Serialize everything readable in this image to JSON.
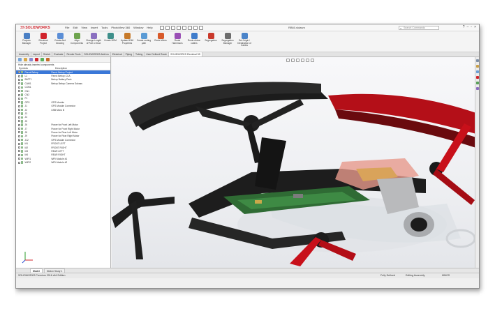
{
  "app": {
    "logo_prefix": "3S",
    "logo_text": "SOLIDWORKS",
    "document_title": "RB60.sldasm",
    "search_placeholder": "Search Commands"
  },
  "menu": [
    "File",
    "Edit",
    "View",
    "Insert",
    "Tools",
    "PhotoView 360",
    "Window",
    "Help"
  ],
  "ribbon": [
    {
      "label": "Projects Manager",
      "color": "#4a7fc4"
    },
    {
      "label": "Electrical Project",
      "color": "#d0232b"
    },
    {
      "label": "Create Add Drawing",
      "color": "#5b8ed6"
    },
    {
      "label": "Align Components",
      "color": "#6da34d"
    },
    {
      "label": "Change Length of Part or Duct",
      "color": "#8a6fc0"
    },
    {
      "label": "Create BOM",
      "color": "#3e8f8a"
    },
    {
      "label": "Update BOM Properties",
      "color": "#c77a2a"
    },
    {
      "label": "Create routing path",
      "color": "#5a9bd5"
    },
    {
      "label": "Route Wires",
      "color": "#d85a2a"
    },
    {
      "label": "Route Harnesses",
      "color": "#9a4fb5"
    },
    {
      "label": "Route ribbon cables",
      "color": "#3f7ccb"
    },
    {
      "label": "Segregation",
      "color": "#c9392b"
    },
    {
      "label": "Segregation Manager",
      "color": "#6c6c6c"
    },
    {
      "label": "Set Origin / Destination of Cables",
      "color": "#4b84c9"
    }
  ],
  "tabs": [
    "Assembly",
    "Layout",
    "Sketch",
    "Evaluate",
    "Render Tools",
    "SOLIDWORKS Add-Ins",
    "Electrical",
    "Piping",
    "Tubing",
    "User Defined Route",
    "SOLIDWORKS Electrical 3D"
  ],
  "active_tab": "SOLIDWORKS Electrical 3D",
  "panel": {
    "hide_label": "Hide already inserted components",
    "col_symbols": "Symbols",
    "col_description": "Description",
    "rows": [
      {
        "symbol": "Parrot Bebop",
        "description": "Parrot Bebop Project",
        "selected": true
      },
      {
        "symbol": "L1",
        "description": "Parrot Bebop CCA"
      },
      {
        "symbol": "BATT1",
        "description": "Bebop Battery Pack"
      },
      {
        "symbol": "CAM1",
        "description": "Bebop Bebop Camera Subass"
      },
      {
        "symbol": "CON1",
        "description": ""
      },
      {
        "symbol": "CN1",
        "description": ""
      },
      {
        "symbol": "CN2",
        "description": ""
      },
      {
        "symbol": "F1",
        "description": ""
      },
      {
        "symbol": "GPS",
        "description": "GPS Module"
      },
      {
        "symbol": "J1",
        "description": "GPS Module Connector"
      },
      {
        "symbol": "J2",
        "description": "USB Micro B"
      },
      {
        "symbol": "J3",
        "description": ""
      },
      {
        "symbol": "J4",
        "description": ""
      },
      {
        "symbol": "J5",
        "description": ""
      },
      {
        "symbol": "J6",
        "description": "Power for Front Left Motor"
      },
      {
        "symbol": "J7",
        "description": "Power for Front Right Motor"
      },
      {
        "symbol": "J8",
        "description": "Power for Rear Left Motor"
      },
      {
        "symbol": "J9",
        "description": "Power for Rear Right Motor"
      },
      {
        "symbol": "J12",
        "description": "GPS Module Connector"
      },
      {
        "symbol": "M1",
        "description": "FRONT LEFT"
      },
      {
        "symbol": "M2",
        "description": "FRONT RIGHT"
      },
      {
        "symbol": "M3",
        "description": "REAR LEFT"
      },
      {
        "symbol": "M4",
        "description": "REAR RIGHT"
      },
      {
        "symbol": "WIFI1",
        "description": "WiFi Module #1"
      },
      {
        "symbol": "WIFI2",
        "description": "WiFi Module #2"
      }
    ]
  },
  "bottom_tabs": [
    "Model",
    "Motion Study 1"
  ],
  "status": {
    "edition": "SOLIDWORKS Premium 2016 x64 Edition",
    "defined": "Fully Defined",
    "editing": "Editing Assembly",
    "units": "MMGS"
  },
  "colors": {
    "brand_red": "#d0232b",
    "selection_blue": "#3a78d8",
    "propeller_red": "#c8101a",
    "pcb_green": "#2f6b34"
  }
}
